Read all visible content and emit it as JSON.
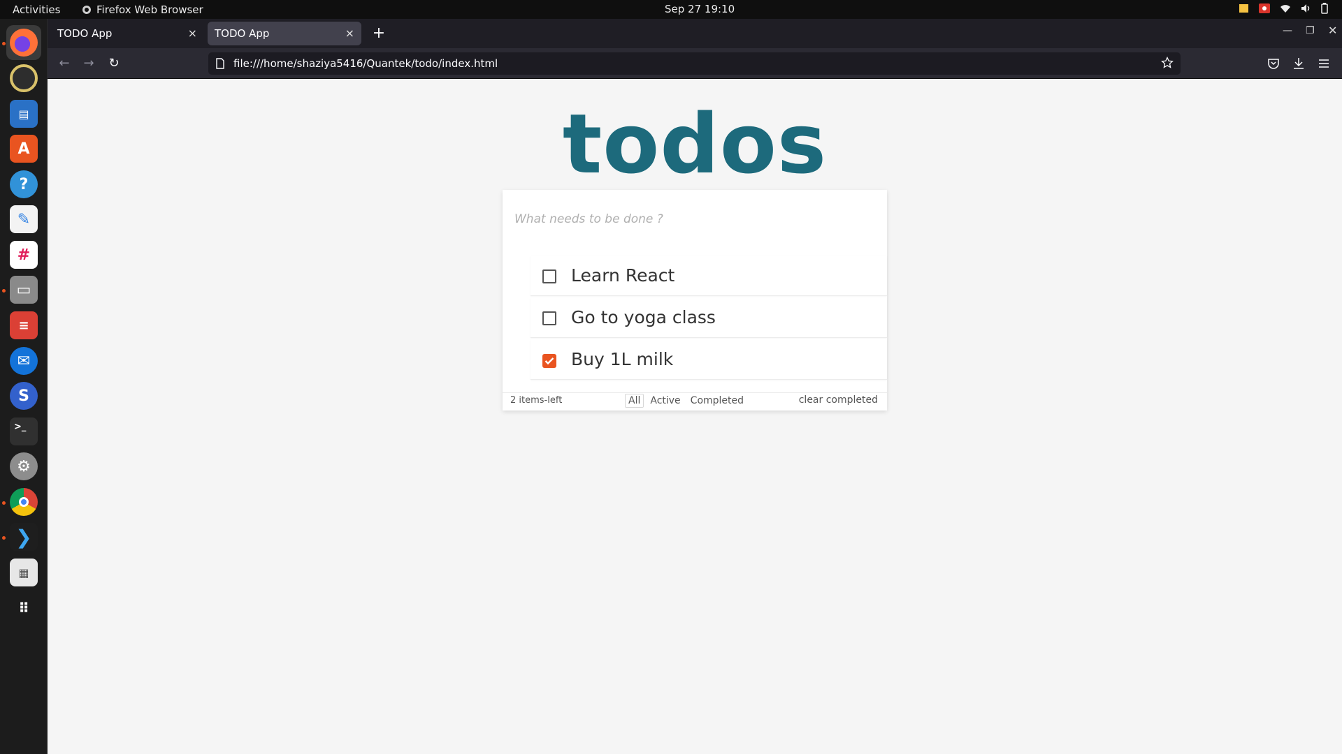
{
  "topbar": {
    "activities": "Activities",
    "app_name": "Firefox Web Browser",
    "clock": "Sep 27  19:10"
  },
  "dock": {
    "items": [
      "firefox-icon",
      "rhythmbox-icon",
      "libreoffice-writer-icon",
      "ubuntu-software-icon",
      "help-icon",
      "text-editor-icon",
      "slack-icon",
      "files-icon",
      "todoist-icon",
      "thunderbird-icon",
      "simplenote-icon",
      "terminal-icon",
      "settings-icon",
      "chrome-icon",
      "vscode-icon",
      "document-viewer-icon",
      "app-grid-icon"
    ]
  },
  "browser": {
    "tabs": [
      {
        "label": "TODO App",
        "close": "×"
      },
      {
        "label": "TODO App",
        "close": "×"
      }
    ],
    "new_tab": "+",
    "url": "file:///home/shaziya5416/Quantek/todo/index.html"
  },
  "app": {
    "title": "todos",
    "input_placeholder": "What needs to be done ?",
    "items": [
      {
        "label": "Learn React",
        "completed": false
      },
      {
        "label": "Go to yoga class",
        "completed": false
      },
      {
        "label": "Buy 1L milk",
        "completed": true
      }
    ],
    "footer": {
      "count": "2 items-left",
      "filters": [
        "All",
        "Active",
        "Completed"
      ],
      "selected_filter": "All",
      "clear": "clear completed"
    }
  },
  "colors": {
    "title": "#1d6a7c",
    "checked": "#e95420"
  }
}
